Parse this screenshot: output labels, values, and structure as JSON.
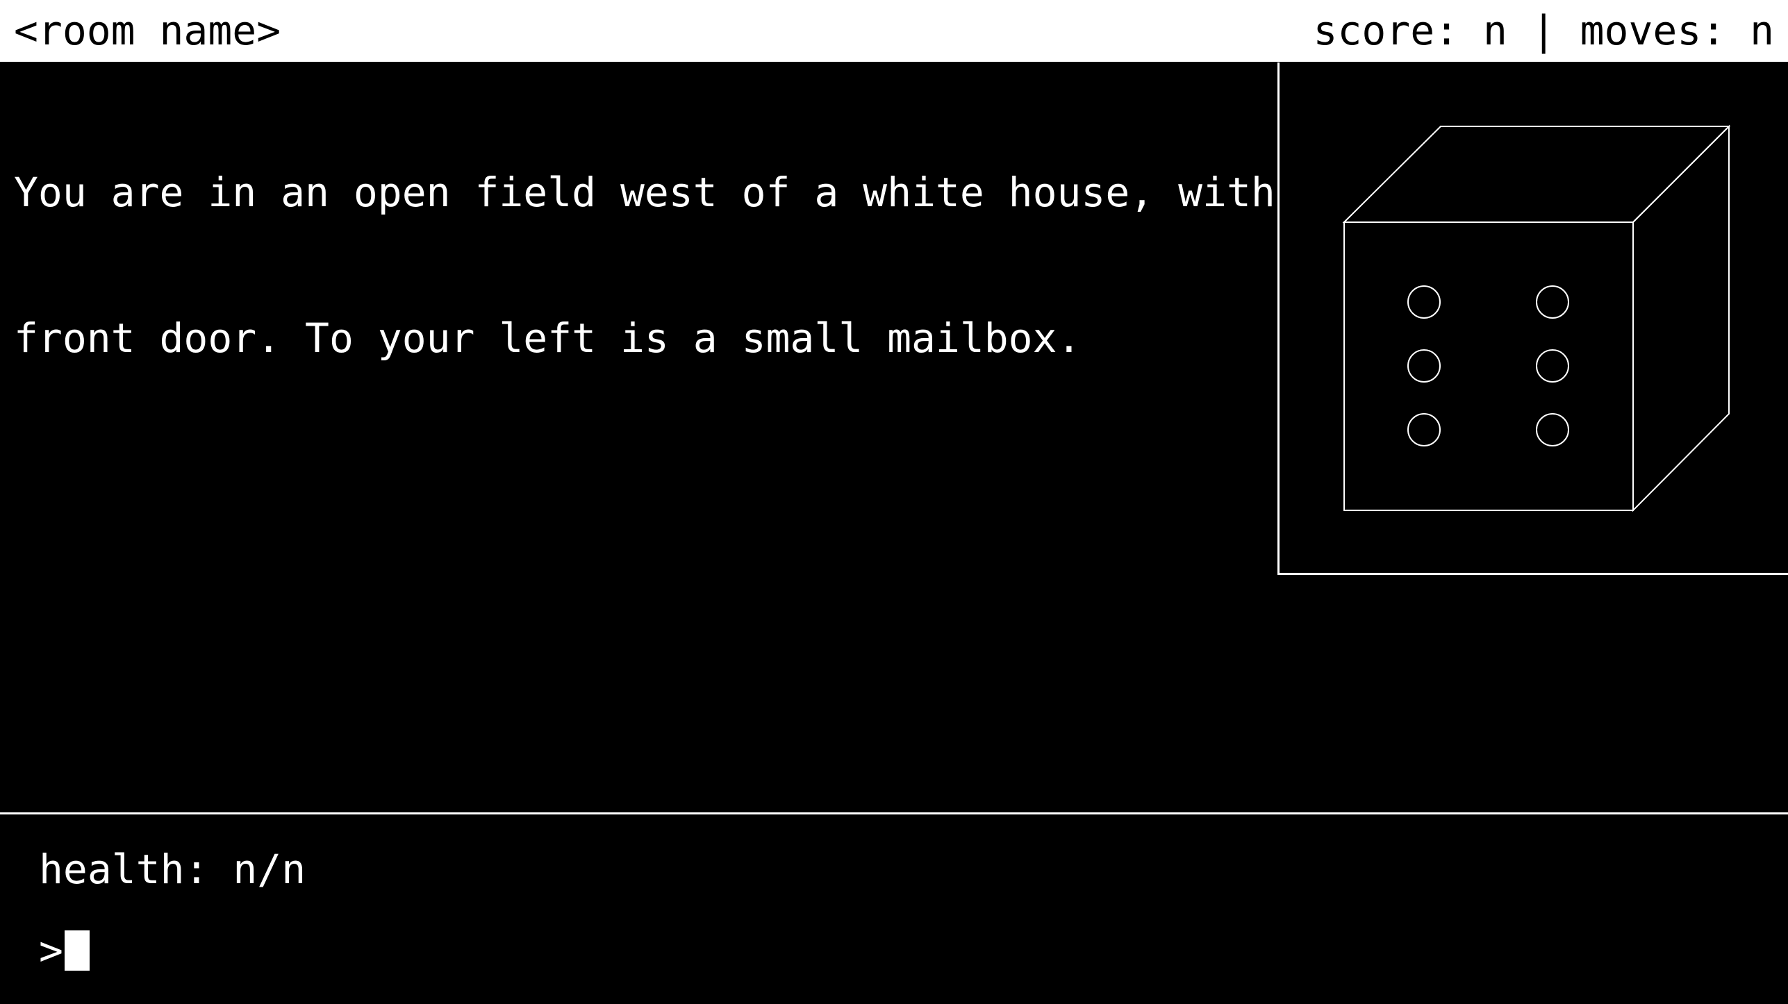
{
  "status_bar": {
    "room_name": "<room name>",
    "score_moves": "score: n | moves: n"
  },
  "main": {
    "description_lines": [
      "You are in an open field west of a white house, with a boarded",
      "front door. To your left is a small mailbox."
    ]
  },
  "image_panel": {
    "subject": "die-showing-six",
    "pip_count": 6
  },
  "footer": {
    "health": "health: n/n",
    "prompt": ">",
    "command_value": ""
  },
  "colors": {
    "background": "#000000",
    "foreground": "#ffffff"
  }
}
